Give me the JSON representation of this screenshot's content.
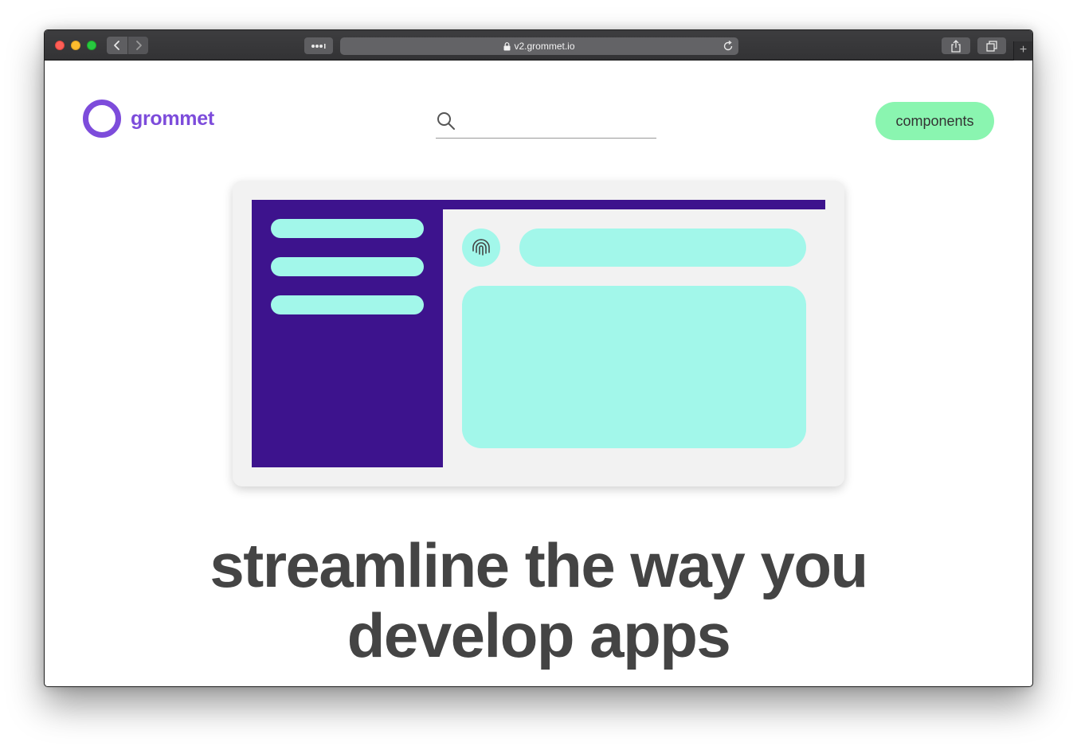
{
  "browser": {
    "url": "v2.grommet.io",
    "icons": {
      "back": "chevron-left-icon",
      "forward": "chevron-right-icon",
      "reader": "reader-dots-icon",
      "lock": "lock-icon",
      "reload": "reload-icon",
      "share": "share-icon",
      "tabs": "tabs-icon",
      "new_tab": "plus-icon"
    },
    "new_tab_glyph": "+"
  },
  "header": {
    "logo_text": "grommet",
    "search_placeholder": "",
    "cta_label": "components"
  },
  "hero": {
    "headline_line1": "streamline the way you",
    "headline_line2": "develop apps"
  },
  "colors": {
    "brand": "#7d4cdb",
    "cta": "#8af5b0",
    "illustration_dark": "#3d138d",
    "illustration_light": "#a2f7ea",
    "headline": "#444444"
  }
}
